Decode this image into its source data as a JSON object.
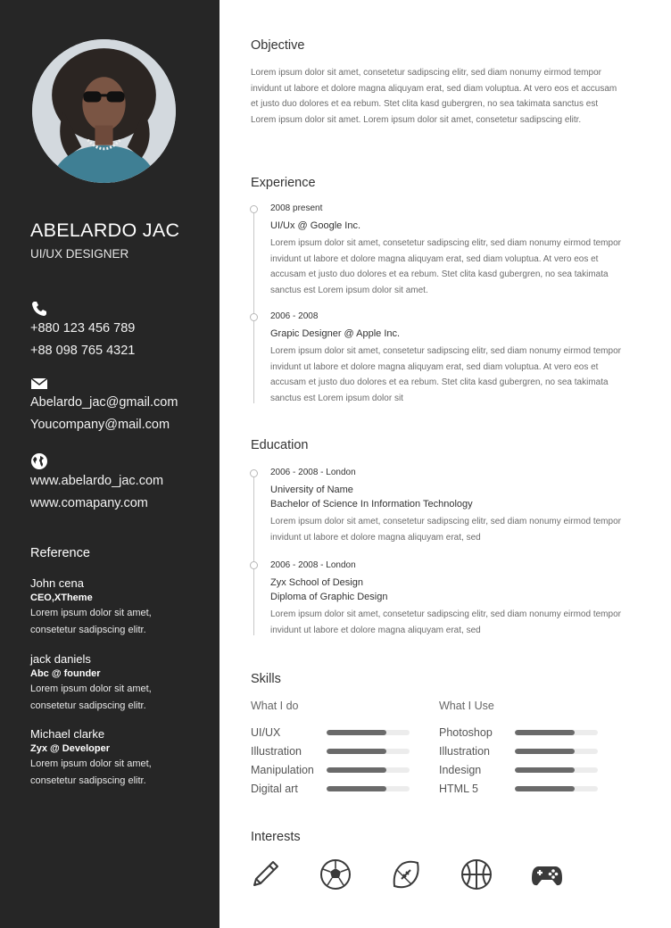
{
  "profile": {
    "name": "ABELARDO JAC",
    "title": "UI/UX DESIGNER"
  },
  "contact": {
    "phones": [
      "+880 123 456 789",
      "+88 098 765 4321"
    ],
    "emails": [
      "Abelardo_jac@gmail.com",
      "Youcompany@mail.com"
    ],
    "websites": [
      "www.abelardo_jac.com",
      "www.comapany.com"
    ]
  },
  "reference": {
    "title": "Reference",
    "items": [
      {
        "name": "John cena",
        "title": "CEO,XTheme",
        "desc1": "Lorem ipsum dolor sit amet,",
        "desc2": "consetetur sadipscing elitr."
      },
      {
        "name": "jack daniels",
        "title": "Abc @ founder",
        "desc1": "Lorem ipsum dolor sit amet,",
        "desc2": "consetetur sadipscing elitr."
      },
      {
        "name": "Michael clarke",
        "title": "Zyx @ Developer",
        "desc1": "Lorem ipsum dolor sit amet,",
        "desc2": "consetetur sadipscing elitr."
      }
    ]
  },
  "objective": {
    "title": "Objective",
    "text": "Lorem ipsum dolor sit amet, consetetur sadipscing elitr, sed diam nonumy eirmod tempor invidunt ut labore et dolore magna aliquyam erat, sed diam voluptua. At vero eos et accusam et justo duo dolores et ea rebum. Stet clita kasd gubergren, no sea takimata sanctus est Lorem ipsum dolor sit amet. Lorem ipsum dolor sit amet, consetetur sadipscing elitr."
  },
  "experience": {
    "title": "Experience",
    "items": [
      {
        "date": "2008 present",
        "role": "UI/Ux @ Google Inc.",
        "desc": "Lorem ipsum dolor sit amet, consetetur sadipscing elitr, sed diam nonumy eirmod tempor invidunt ut labore et dolore magna aliquyam erat, sed diam voluptua. At vero eos et accusam et justo duo dolores et ea rebum. Stet clita kasd gubergren, no sea takimata sanctus est Lorem ipsum dolor sit amet."
      },
      {
        "date": "2006 - 2008",
        "role": "Grapic Designer @ Apple Inc.",
        "desc": "Lorem ipsum dolor sit amet, consetetur sadipscing elitr, sed diam nonumy eirmod tempor invidunt ut labore et dolore magna aliquyam erat, sed diam voluptua. At vero eos et accusam et justo duo dolores et ea rebum. Stet clita kasd gubergren, no sea takimata sanctus est Lorem ipsum dolor sit"
      }
    ]
  },
  "education": {
    "title": "Education",
    "items": [
      {
        "date": "2006 - 2008 - London",
        "school": "University of Name",
        "degree": "Bachelor of Science In Information Technology",
        "desc": "Lorem ipsum dolor sit amet, consetetur sadipscing elitr, sed diam nonumy eirmod tempor invidunt ut labore et dolore magna aliquyam erat, sed"
      },
      {
        "date": "2006 - 2008 - London",
        "school": "Zyx School of Design",
        "degree": "Diploma of Graphic Design",
        "desc": "Lorem ipsum dolor sit amet, consetetur sadipscing elitr, sed diam nonumy eirmod tempor invidunt ut labore et dolore magna aliquyam erat, sed"
      }
    ]
  },
  "skills": {
    "title": "Skills",
    "what_i_do": {
      "title": "What I do",
      "items": [
        {
          "label": "UI/UX",
          "level": 0.72
        },
        {
          "label": "Illustration",
          "level": 0.72
        },
        {
          "label": "Manipulation",
          "level": 0.72
        },
        {
          "label": "Digital art",
          "level": 0.72
        }
      ]
    },
    "what_i_use": {
      "title": "What I Use",
      "items": [
        {
          "label": "Photoshop",
          "level": 0.72
        },
        {
          "label": "Illustration",
          "level": 0.72
        },
        {
          "label": "Indesign",
          "level": 0.72
        },
        {
          "label": "HTML 5",
          "level": 0.72
        }
      ]
    }
  },
  "interests": {
    "title": "Interests",
    "icons": [
      "pencil-icon",
      "soccer-ball-icon",
      "american-football-icon",
      "basketball-icon",
      "gamepad-icon"
    ]
  },
  "colors": {
    "sidebar_bg": "#262626",
    "skill_fill": "#6a6a6a",
    "skill_track": "#ececec"
  }
}
